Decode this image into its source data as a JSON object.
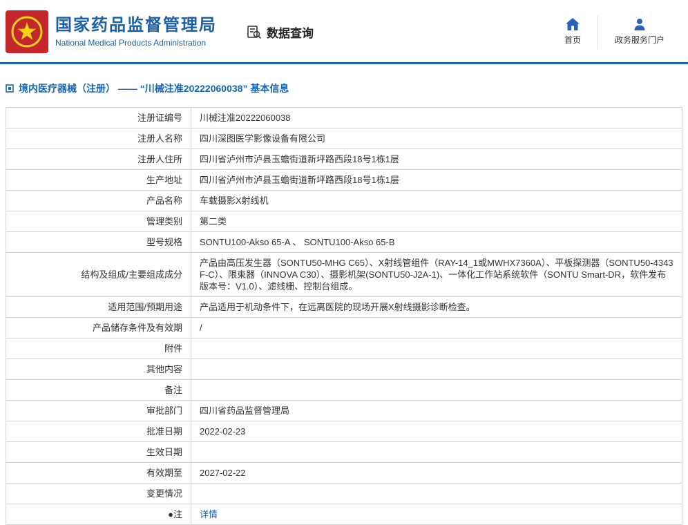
{
  "colors": {
    "brand_blue": "#1b5fa7",
    "logo_red": "#c3272b",
    "emblem_gold": "#f7d117",
    "title_blue": "#1464b4",
    "divider_blue": "#2268b0",
    "border_gray": "#d6d6d6"
  },
  "header": {
    "org_cn": "国家药品监督管理局",
    "org_en": "National Medical Products Administration",
    "query_label": "数据查询",
    "home_label": "首页",
    "portal_label": "政务服务门户"
  },
  "page": {
    "title": "境内医疗器械（注册） —— “川械注准20222060038” 基本信息"
  },
  "table": {
    "rows": [
      {
        "label": "注册证编号",
        "value": "川械注准20222060038"
      },
      {
        "label": "注册人名称",
        "value": "四川深图医学影像设备有限公司"
      },
      {
        "label": "注册人住所",
        "value": "四川省泸州市泸县玉蟾街道新坪路西段18号1栋1层"
      },
      {
        "label": "生产地址",
        "value": "四川省泸州市泸县玉蟾街道新坪路西段18号1栋1层"
      },
      {
        "label": "产品名称",
        "value": "车载摄影X射线机"
      },
      {
        "label": "管理类别",
        "value": "第二类"
      },
      {
        "label": "型号规格",
        "value": "SONTU100-Akso 65-A 、 SONTU100-Akso 65-B"
      },
      {
        "label": "结构及组成/主要组成成分",
        "value": "产品由高压发生器（SONTU50-MHG C65）、X射线管组件（RAY-14_1或MWHX7360A）、平板探测器（SONTU50-4343F-C）、限束器（INNOVA C30）、摄影机架(SONTU50-J2A-1)、一体化工作站系统软件（SONTU Smart-DR，软件发布版本号：V1.0）、滤线栅、控制台组成。"
      },
      {
        "label": "适用范围/预期用途",
        "value": "产品适用于机动条件下，在远离医院的现场开展X射线摄影诊断检查。"
      },
      {
        "label": "产品储存条件及有效期",
        "value": "/"
      },
      {
        "label": "附件",
        "value": ""
      },
      {
        "label": "其他内容",
        "value": ""
      },
      {
        "label": "备注",
        "value": ""
      },
      {
        "label": "审批部门",
        "value": "四川省药品监督管理局"
      },
      {
        "label": "批准日期",
        "value": "2022-02-23"
      },
      {
        "label": "生效日期",
        "value": ""
      },
      {
        "label": "有效期至",
        "value": "2027-02-22"
      },
      {
        "label": "变更情况",
        "value": ""
      },
      {
        "label": "●注",
        "value": "详情",
        "link": true
      }
    ]
  }
}
